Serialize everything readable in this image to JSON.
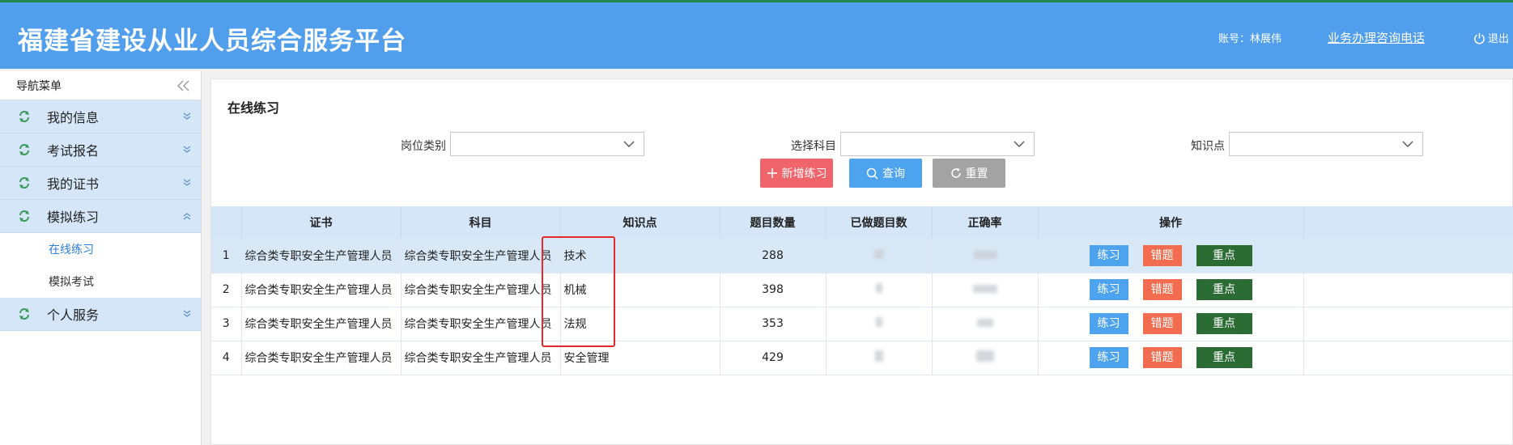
{
  "header": {
    "brand": "福建省建设从业人员综合服务平台",
    "account": "账号：林展伟",
    "hotline": "业务办理咨询电话",
    "logout": "退出"
  },
  "sidebar": {
    "title": "导航菜单",
    "items": [
      {
        "label": "我的信息"
      },
      {
        "label": "考试报名"
      },
      {
        "label": "我的证书"
      },
      {
        "label": "模拟练习",
        "expanded": true,
        "children": [
          {
            "label": "在线练习",
            "active": true
          },
          {
            "label": "模拟考试"
          }
        ]
      },
      {
        "label": "个人服务"
      }
    ]
  },
  "main": {
    "title": "在线练习",
    "filters": {
      "post_label": "岗位类别",
      "subject_label": "选择科目",
      "knowledge_label": "知识点"
    },
    "buttons": {
      "add": "新增练习",
      "query": "查询",
      "reset": "重置"
    },
    "table": {
      "headers": [
        "证书",
        "科目",
        "知识点",
        "题目数量",
        "已做题目数",
        "正确率",
        "操作"
      ],
      "rows": [
        {
          "no": "1",
          "cert": "综合类专职安全生产管理人员",
          "subject": "综合类专职安全生产管理人员",
          "knowledge": "技术",
          "count": "288"
        },
        {
          "no": "2",
          "cert": "综合类专职安全生产管理人员",
          "subject": "综合类专职安全生产管理人员",
          "knowledge": "机械",
          "count": "398"
        },
        {
          "no": "3",
          "cert": "综合类专职安全生产管理人员",
          "subject": "综合类专职安全生产管理人员",
          "knowledge": "法规",
          "count": "353"
        },
        {
          "no": "4",
          "cert": "综合类专职安全生产管理人员",
          "subject": "综合类专职安全生产管理人员",
          "knowledge": "安全管理",
          "count": "429"
        }
      ],
      "actions": {
        "practice": "练习",
        "wrong": "错题",
        "key": "重点"
      }
    }
  },
  "colors": {
    "header_bg": "#519fec",
    "menu_bg": "#d5e6f8",
    "btn_add": "#f0646b",
    "btn_query": "#4ea3ee",
    "btn_reset": "#a3a3a3",
    "btn_wrong": "#f26d4f",
    "btn_key": "#2b6b34",
    "highlight_box": "#e2292c"
  }
}
